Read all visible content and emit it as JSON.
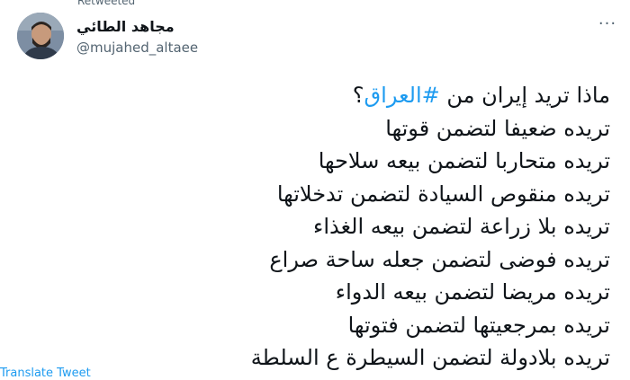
{
  "retweet": {
    "label": "Retweeted"
  },
  "author": {
    "name": "مجاهد الطائي",
    "handle": "@mujahed_altaee"
  },
  "menu": {
    "more_icon": "more-horizontal-icon",
    "more_label": "···"
  },
  "tweet": {
    "first_line_prefix": "ماذا تريد إيران من ",
    "hashtag": "#العراق",
    "first_line_suffix": "؟",
    "lines": [
      "تريده ضعيفا لتضمن قوتها",
      "تريده متحاربا لتضمن بيعه سلاحها",
      "تريده منقوص السيادة لتضمن تدخلاتها",
      "تريده بلا زراعة لتضمن بيعه الغذاء",
      "تريده فوضى لتضمن جعله ساحة صراع",
      "تريده مريضا لتضمن بيعه الدواء",
      "تريده بمرجعيتها لتضمن فتوتها",
      "تريده بلادولة لتضمن السيطرة ع السلطة"
    ]
  },
  "translate": {
    "label": "Translate Tweet"
  },
  "colors": {
    "accent": "#1d9bf0",
    "text": "#0f1419",
    "secondary": "#536471"
  }
}
